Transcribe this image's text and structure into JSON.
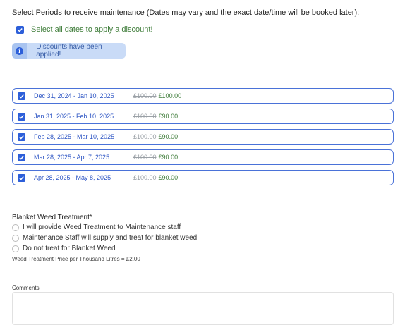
{
  "intro_text": "Select Periods to receive maintenance (Dates may vary and the exact date/time will be booked later):",
  "select_all_label": "Select all dates to apply a discount!",
  "banner_text": "Discounts have been applied!",
  "periods": [
    {
      "dates": "Dec 31, 2024 - Jan 10, 2025",
      "old_price": "£100.00",
      "new_price": "£100.00",
      "checked": true
    },
    {
      "dates": "Jan 31, 2025 - Feb 10, 2025",
      "old_price": "£100.00",
      "new_price": "£90.00",
      "checked": true
    },
    {
      "dates": "Feb 28, 2025 - Mar 10, 2025",
      "old_price": "£100.00",
      "new_price": "£90.00",
      "checked": true
    },
    {
      "dates": "Mar 28, 2025 - Apr 7, 2025",
      "old_price": "£100.00",
      "new_price": "£90.00",
      "checked": true
    },
    {
      "dates": "Apr 28, 2025 - May 8, 2025",
      "old_price": "£100.00",
      "new_price": "£90.00",
      "checked": true
    }
  ],
  "weed_treatment": {
    "title": "Blanket Weed Treatment*",
    "options": [
      "I will provide Weed Treatment to Maintenance staff",
      "Maintenance Staff will supply and treat for blanket weed",
      "Do not treat for Blanket Weed"
    ],
    "price_note": "Weed Treatment Price per Thousand Litres = £2.00"
  },
  "comments": {
    "label": "Comments",
    "value": ""
  },
  "colors": {
    "accent": "#2d5fd9",
    "discount_green": "#3f7d3a",
    "banner_bg": "#c9dbf7"
  }
}
